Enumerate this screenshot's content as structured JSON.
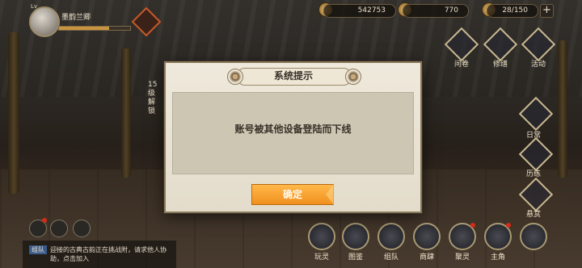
{
  "player": {
    "level": "Lv",
    "name": "墨韵兰卿"
  },
  "resources": [
    {
      "name": "coins",
      "value": "542753"
    },
    {
      "name": "gems",
      "value": "770"
    },
    {
      "name": "stamina",
      "value": "28/150"
    }
  ],
  "banner": {
    "text": "15级解锁"
  },
  "right_menu": [
    {
      "icon": "book-icon",
      "label": "问卷"
    },
    {
      "icon": "repair-icon",
      "label": "修缮"
    },
    {
      "icon": "activity-icon",
      "label": "活动"
    }
  ],
  "side_menu": [
    {
      "icon": "daily-icon",
      "label": "日常"
    },
    {
      "icon": "training-icon",
      "label": "历练"
    },
    {
      "icon": "bounty-icon",
      "label": "悬赏"
    }
  ],
  "bottom_nav": [
    {
      "icon": "spirit-icon",
      "label": "玩灵"
    },
    {
      "icon": "album-icon",
      "label": "图鉴"
    },
    {
      "icon": "team-icon",
      "label": "组队"
    },
    {
      "icon": "shop-icon",
      "label": "商肆"
    },
    {
      "icon": "gather-icon",
      "label": "聚灵"
    },
    {
      "icon": "character-icon",
      "label": "主角"
    },
    {
      "icon": "settings-icon",
      "label": ""
    }
  ],
  "chat": {
    "tag": "组队",
    "message": "迎接的古典古韵正在挑战附，请求他人协助，点击加入"
  },
  "dialog": {
    "title": "系统提示",
    "message": "账号被其他设备登陆而下线",
    "confirm_label": "确定"
  },
  "colors": {
    "accent": "#f0901e",
    "dialog_bg": "#e8e2d3",
    "badge_red": "#d62a1a"
  }
}
